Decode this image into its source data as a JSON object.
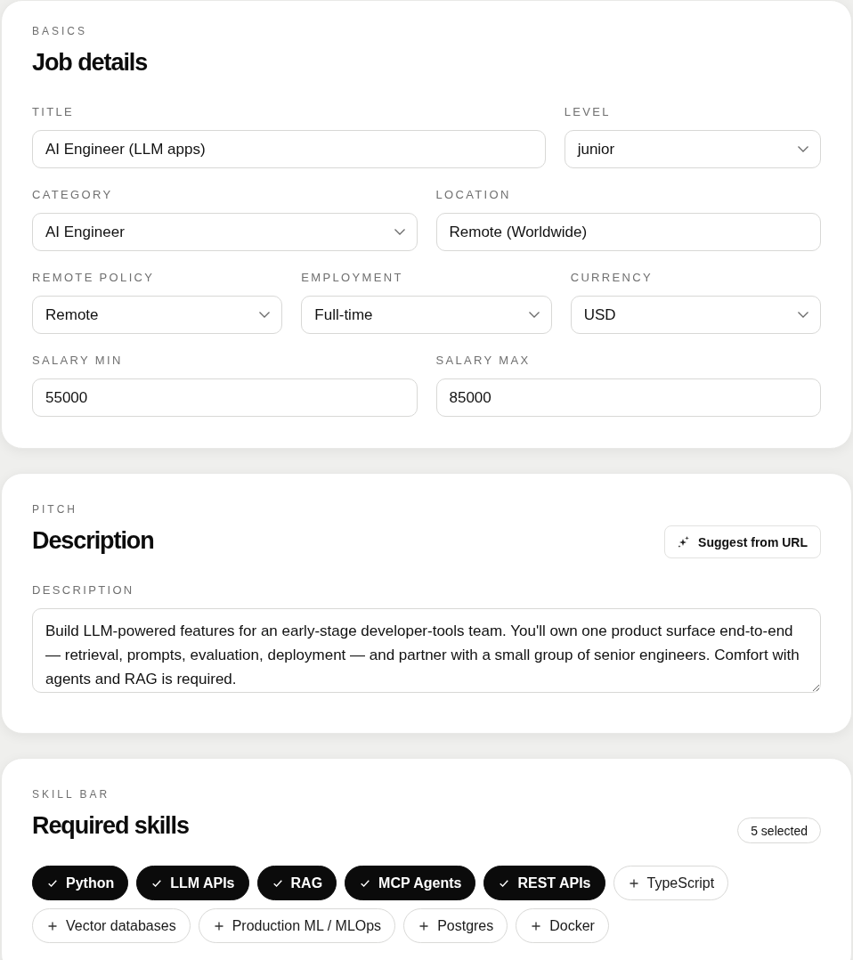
{
  "sections": [
    {
      "kind": "form",
      "eyebrow": "BASICS",
      "heading": "Job details",
      "rows": [
        [
          {
            "label": "TITLE",
            "kind": "text",
            "value": "AI Engineer (LLM apps)"
          },
          {
            "label": "LEVEL",
            "kind": "select",
            "value": "junior"
          }
        ],
        [
          {
            "label": "CATEGORY",
            "kind": "select",
            "value": "AI Engineer"
          },
          {
            "label": "LOCATION",
            "kind": "text",
            "value": "Remote (Worldwide)"
          }
        ],
        [
          {
            "label": "REMOTE POLICY",
            "kind": "select",
            "value": "Remote"
          },
          {
            "label": "EMPLOYMENT",
            "kind": "select",
            "value": "Full-time"
          },
          {
            "label": "CURRENCY",
            "kind": "select",
            "value": "USD"
          }
        ],
        [
          {
            "label": "SALARY MIN",
            "kind": "text",
            "value": "55000"
          },
          {
            "label": "SALARY MAX",
            "kind": "text",
            "value": "85000"
          }
        ]
      ]
    },
    {
      "kind": "text",
      "eyebrow": "PITCH",
      "heading": "Description",
      "action": {
        "label": "Suggest from URL"
      },
      "field": {
        "label": "DESCRIPTION",
        "value": "Build LLM-powered features for an early-stage developer-tools team. You'll own one product surface end-to-end — retrieval, prompts, evaluation, deployment — and partner with a small group of senior engineers. Comfort with agents and RAG is required."
      }
    },
    {
      "kind": "skills",
      "eyebrow": "SKILL BAR",
      "heading": "Required skills",
      "badge": "5 selected",
      "skills": [
        {
          "label": "Python",
          "selected": true
        },
        {
          "label": "LLM APIs",
          "selected": true
        },
        {
          "label": "RAG",
          "selected": true
        },
        {
          "label": "MCP Agents",
          "selected": true
        },
        {
          "label": "REST APIs",
          "selected": true
        },
        {
          "label": "TypeScript",
          "selected": false
        },
        {
          "label": "Vector databases",
          "selected": false
        },
        {
          "label": "Production ML / MLOps",
          "selected": false
        },
        {
          "label": "Postgres",
          "selected": false
        },
        {
          "label": "Docker",
          "selected": false
        }
      ]
    }
  ]
}
